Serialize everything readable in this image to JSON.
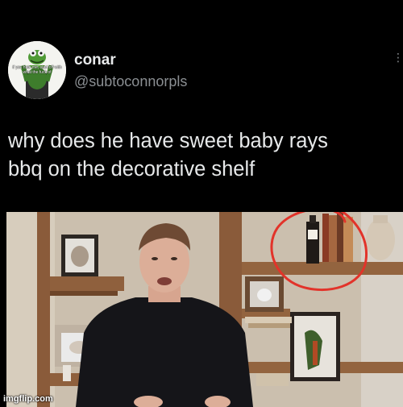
{
  "tweet": {
    "author": {
      "display_name": "conar",
      "handle": "@subtoconnorpls",
      "avatar_caption": "if you hate me, start off with what the fuck of"
    },
    "more_icon": "three-dots-icon",
    "text_line1": "why does he have sweet baby rays",
    "text_line2": "bbq on the decorative shelf",
    "media": {
      "annotation_color": "#e2332a"
    }
  },
  "watermark": "imgflip.com"
}
